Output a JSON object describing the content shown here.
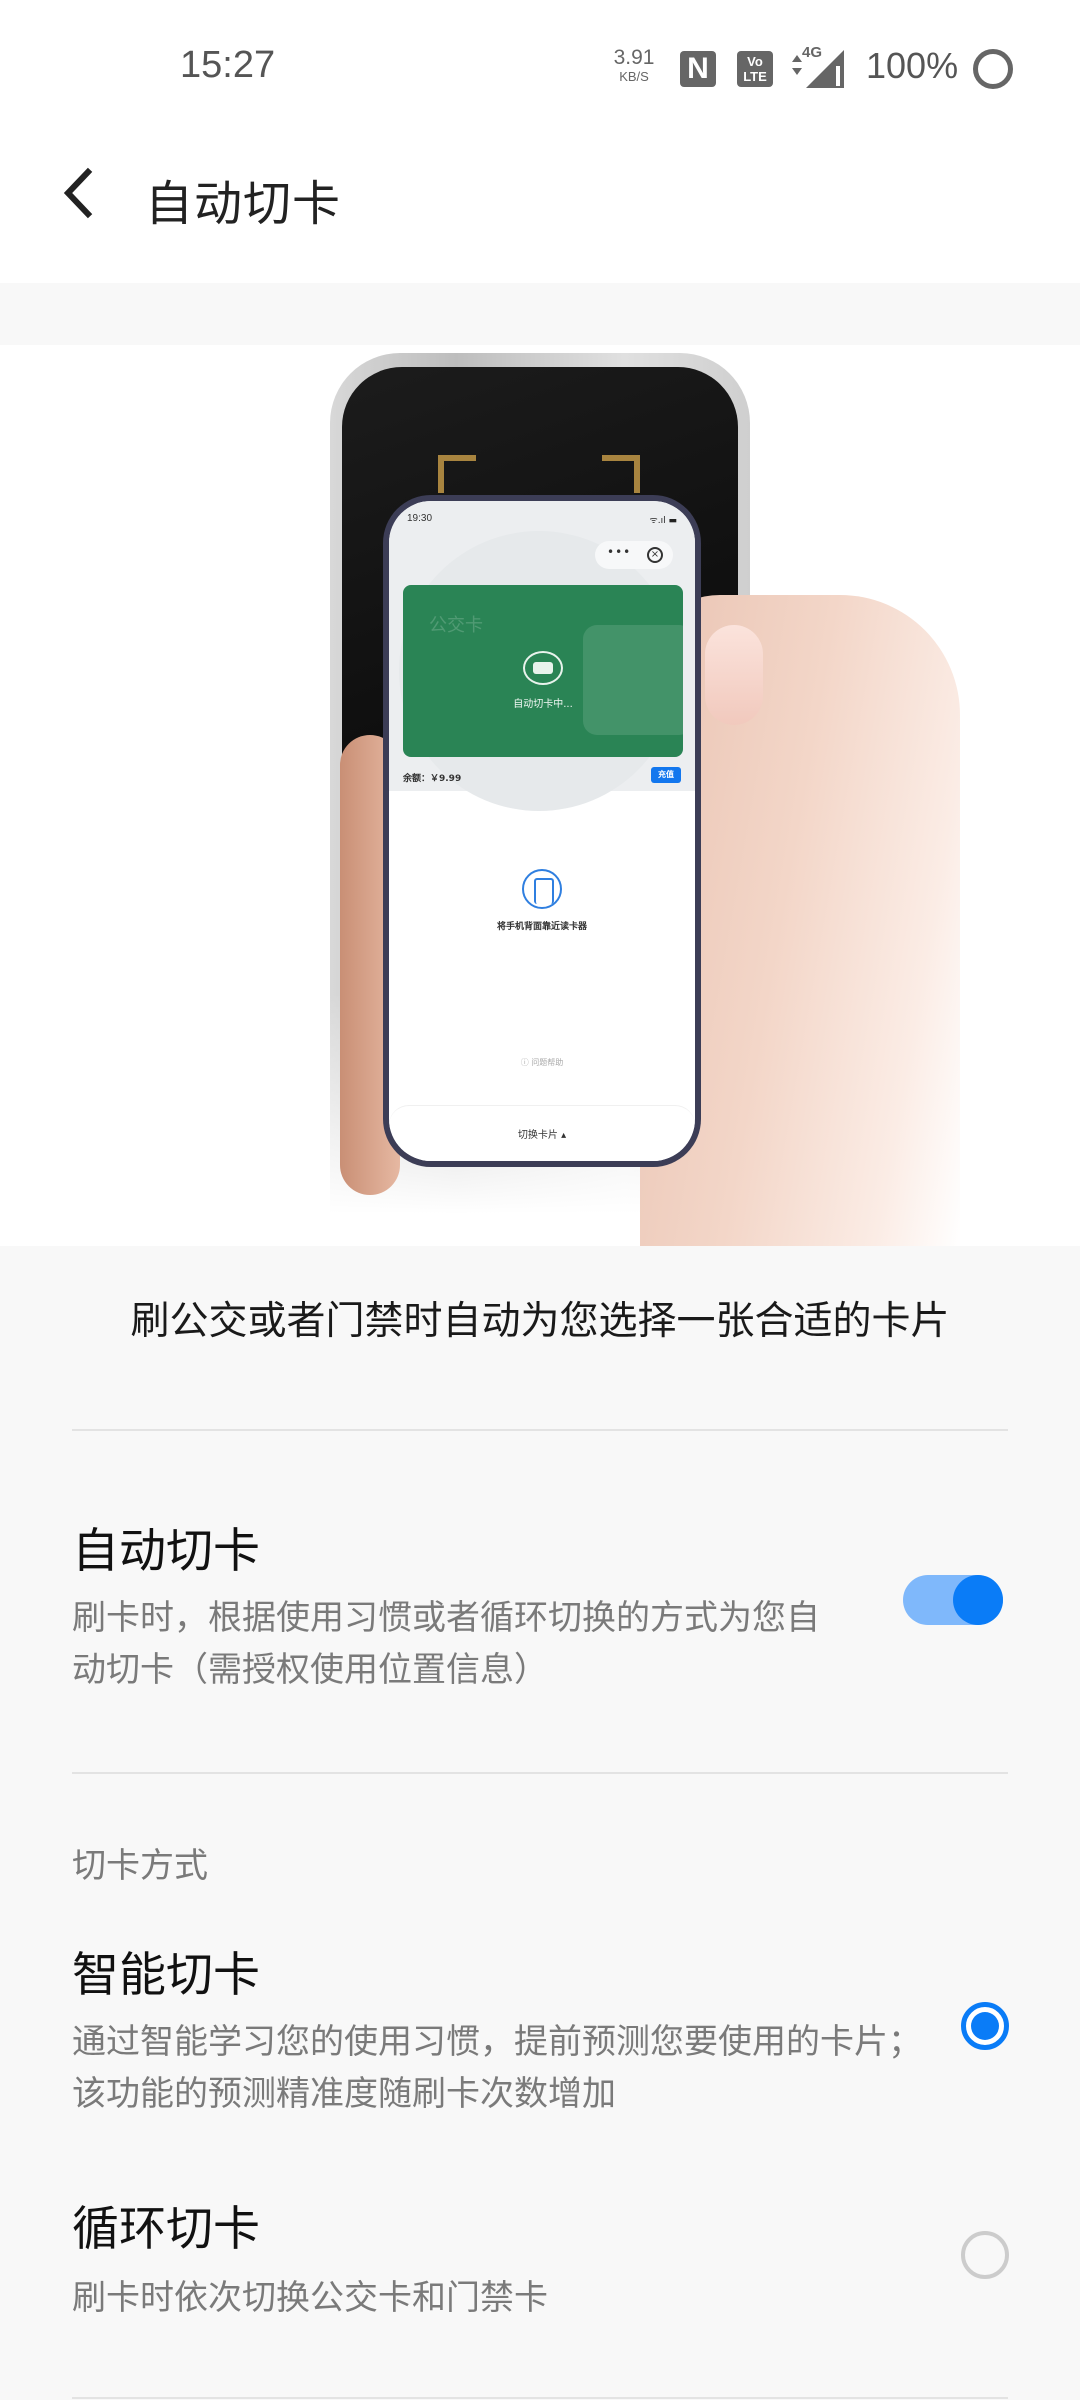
{
  "status_bar": {
    "time": "15:27",
    "net_speed_value": "3.91",
    "net_speed_unit": "KB/S",
    "nfc_icon_label": "N",
    "volte_top": "Vo",
    "volte_bottom": "LTE",
    "network_type": "4G",
    "battery_percent": "100%"
  },
  "header": {
    "back_icon": "chevron-left-icon",
    "title": "自动切卡"
  },
  "illustration": {
    "inner_phone_time": "19:30",
    "inner_phone_status_icons": "ᯤ.ıl ▬",
    "capsule_more": "•••",
    "capsule_close": "×",
    "card_name": "公交卡",
    "card_status": "自动切卡中...",
    "balance": "余额：￥9.99",
    "recharge_button": "充值",
    "tap_hint": "将手机背面靠近读卡器",
    "help_link": "ⓘ 问题帮助",
    "switch_card": "切换卡片 ▴"
  },
  "intro": "刷公交或者门禁时自动为您选择一张合适的卡片",
  "auto_switch": {
    "title": "自动切卡",
    "description": "刷卡时，根据使用习惯或者循环切换的方式为您自动切卡（需授权使用位置信息）",
    "enabled": true
  },
  "mode_section": {
    "label": "切卡方式",
    "options": [
      {
        "title": "智能切卡",
        "description": "通过智能学习您的使用习惯，提前预测您要使用的卡片；该功能的预测精准度随刷卡次数增加",
        "selected": true
      },
      {
        "title": "循环切卡",
        "description": "刷卡时依次切换公交卡和门禁卡",
        "selected": false
      }
    ]
  },
  "colors": {
    "accent": "#0a7cf7",
    "toggle_track": "#7fb8fb",
    "card_green": "#2a8455",
    "text_primary": "#111111",
    "text_secondary": "#7a7a7a"
  }
}
